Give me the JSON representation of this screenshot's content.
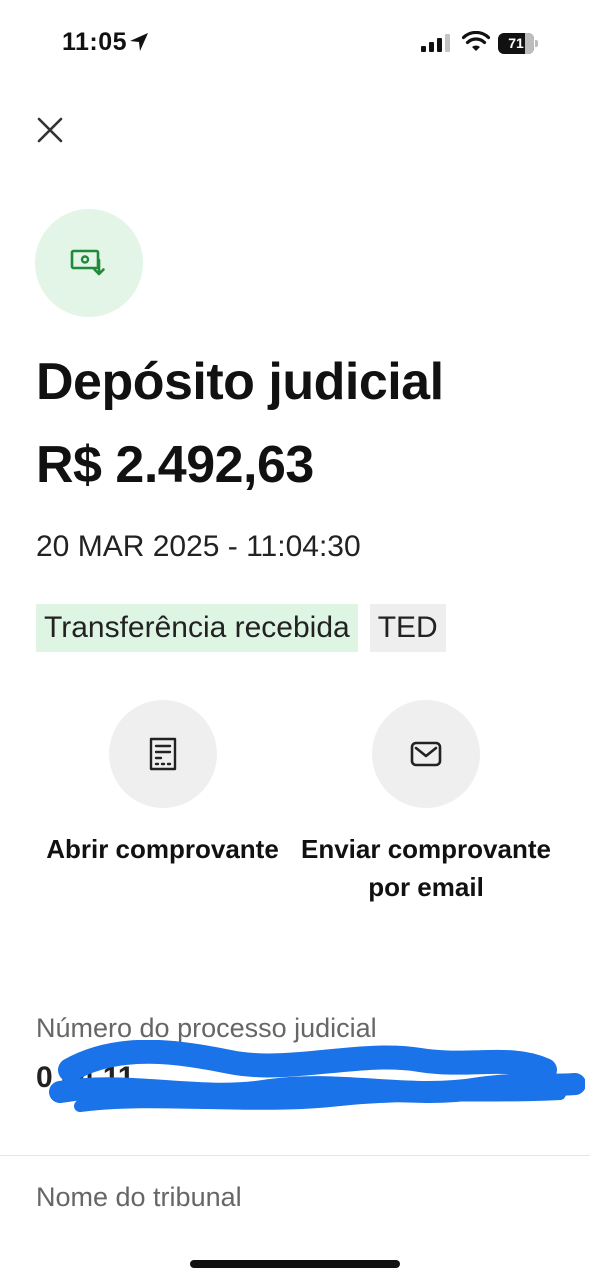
{
  "status_bar": {
    "time": "11:05",
    "battery": "71"
  },
  "header": {
    "title": "Depósito judicial",
    "amount": "R$ 2.492,63",
    "datetime": "20 MAR 2025 - 11:04:30"
  },
  "tags": [
    "Transferência recebida",
    "TED"
  ],
  "actions": [
    {
      "label": "Abrir comprovante",
      "icon": "receipt-icon"
    },
    {
      "label": "Enviar comprovante por email",
      "icon": "envelope-icon"
    }
  ],
  "fields": [
    {
      "label": "Número do processo judicial",
      "value": "0 04 11"
    },
    {
      "label": "Nome do tribunal"
    }
  ],
  "colors": {
    "accent_green": "#1f8a3b",
    "tag_green_bg": "#dff5e4",
    "scribble_blue": "#1a73e8"
  }
}
